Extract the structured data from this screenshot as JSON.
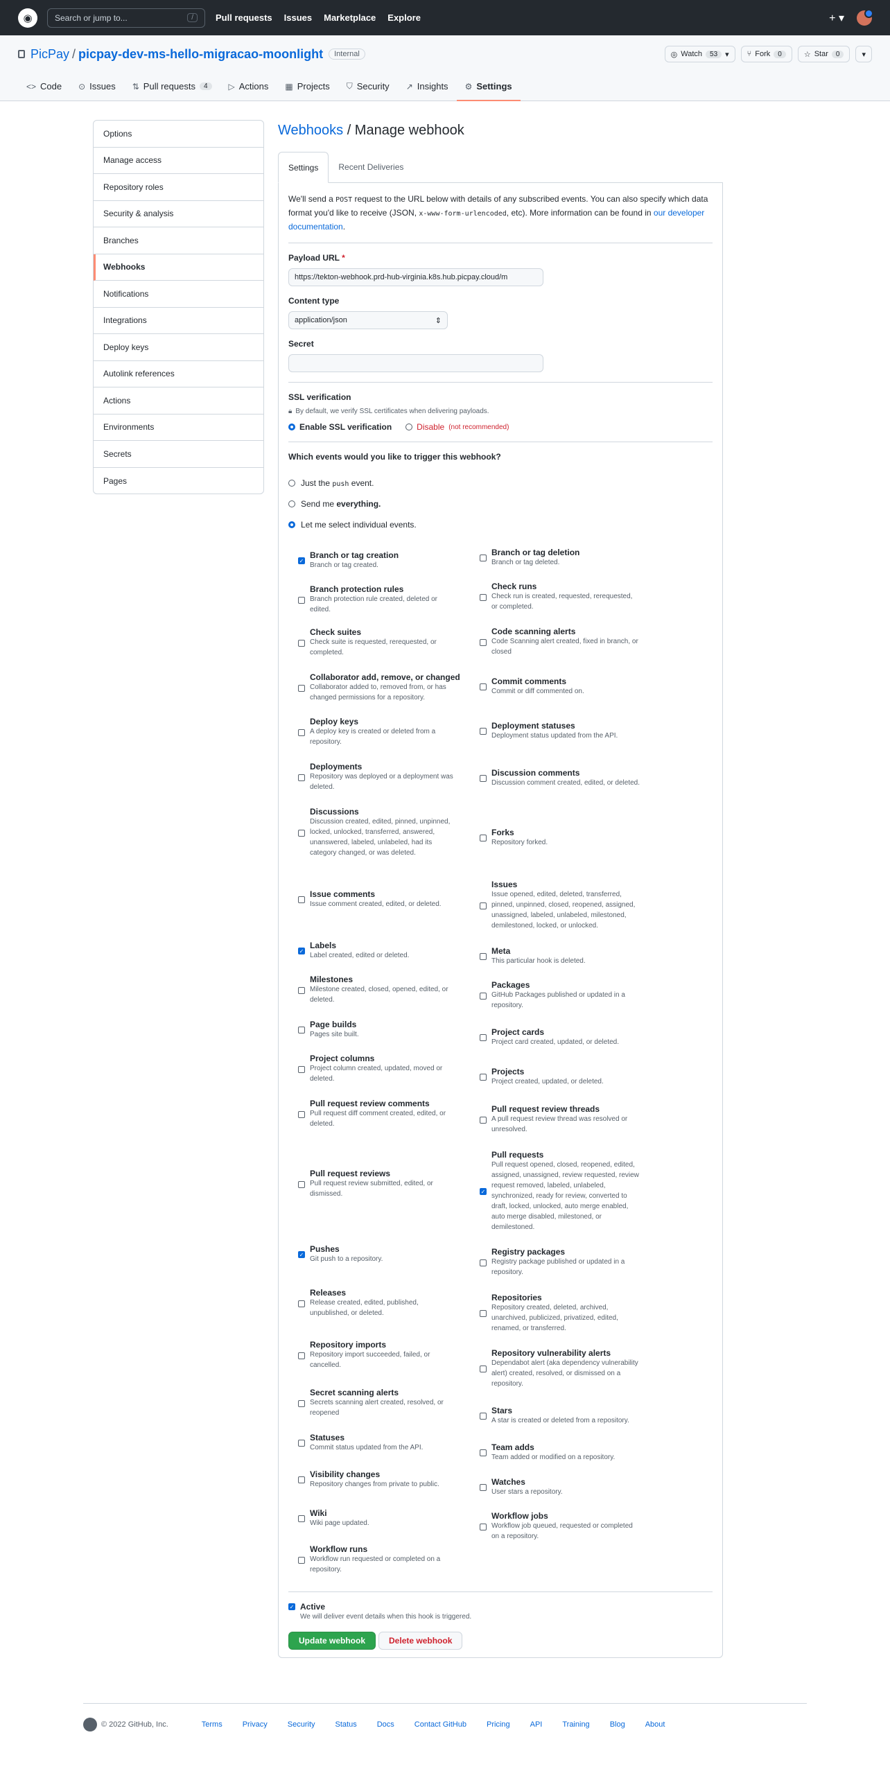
{
  "header": {
    "search_placeholder": "Search or jump to...",
    "search_key": "/",
    "nav": [
      "Pull requests",
      "Issues",
      "Marketplace",
      "Explore"
    ],
    "plus": "+ ▾"
  },
  "repo": {
    "owner": "PicPay",
    "name": "picpay-dev-ms-hello-migracao-moonlight",
    "visibility": "Internal",
    "watch_label": "Watch",
    "watch_count": "53",
    "fork_label": "Fork",
    "fork_count": "0",
    "star_label": "Star",
    "star_count": "0"
  },
  "tabs": [
    {
      "label": "Code",
      "icon": "<>"
    },
    {
      "label": "Issues",
      "icon": "⊙"
    },
    {
      "label": "Pull requests",
      "icon": "⇅",
      "count": "4"
    },
    {
      "label": "Actions",
      "icon": "▷"
    },
    {
      "label": "Projects",
      "icon": "▦"
    },
    {
      "label": "Security",
      "icon": "⛉"
    },
    {
      "label": "Insights",
      "icon": "↗"
    },
    {
      "label": "Settings",
      "icon": "⚙"
    }
  ],
  "sidebar": [
    "Options",
    "Manage access",
    "Repository roles",
    "Security & analysis",
    "Branches",
    "Webhooks",
    "Notifications",
    "Integrations",
    "Deploy keys",
    "Autolink references",
    "Actions",
    "Environments",
    "Secrets",
    "Pages"
  ],
  "page": {
    "title_link": "Webhooks",
    "title_rest": " / Manage webhook",
    "tab_settings": "Settings",
    "tab_deliveries": "Recent Deliveries",
    "intro_1": "We'll send a ",
    "intro_code1": "POST",
    "intro_2": " request to the URL below with details of any subscribed events. You can also specify which data format you'd like to receive (JSON, ",
    "intro_code2": "x-www-form-urlencoded",
    "intro_3": ", etc). More information can be found in ",
    "intro_link": "our developer documentation",
    "intro_4": ".",
    "payload_label": "Payload URL",
    "payload_value": "https://tekton-webhook.prd-hub-virginia.k8s.hub.picpay.cloud/m",
    "content_type_label": "Content type",
    "content_type_value": "application/json",
    "secret_label": "Secret",
    "ssl_label": "SSL verification",
    "ssl_note": "By default, we verify SSL certificates when delivering payloads.",
    "ssl_enable": "Enable SSL verification",
    "ssl_disable": "Disable",
    "ssl_disable_note": "(not recommended)",
    "events_question": "Which events would you like to trigger this webhook?",
    "opt_push_1": "Just the ",
    "opt_push_code": "push",
    "opt_push_2": " event.",
    "opt_all_1": "Send me ",
    "opt_all_2": "everything.",
    "opt_select": "Let me select individual events.",
    "active_label": "Active",
    "active_note": "We will deliver event details when this hook is triggered.",
    "update_button": "Update webhook",
    "delete_button": "Delete webhook"
  },
  "events_left": [
    {
      "name": "Branch or tag creation",
      "desc": "Branch or tag created.",
      "checked": true,
      "h": 56
    },
    {
      "name": "Branch protection rules",
      "desc": "Branch protection rule created, deleted or edited.",
      "checked": false,
      "h": 58
    },
    {
      "name": "Check suites",
      "desc": "Check suite is requested, rerequested, or completed.",
      "checked": false,
      "h": 66
    },
    {
      "name": "Collaborator add, remove, or changed",
      "desc": "Collaborator added to, removed from, or has changed permissions for a repository.",
      "checked": false,
      "h": 64
    },
    {
      "name": "Deploy keys",
      "desc": "A deploy key is created or deleted from a repository.",
      "checked": false,
      "h": 64
    },
    {
      "name": "Deployments",
      "desc": "Repository was deployed or a deployment was deleted.",
      "checked": false,
      "h": 66
    },
    {
      "name": "Discussions",
      "desc": "Discussion created, edited, pinned, unpinned, locked, unlocked, transferred, answered, unanswered, labeled, unlabeled, had its category changed, or was deleted.",
      "checked": false,
      "h": 94
    },
    {
      "name": "Issue comments",
      "desc": "Issue comment created, edited, or deleted.",
      "checked": false,
      "h": 98
    },
    {
      "name": "Labels",
      "desc": "Label created, edited or deleted.",
      "checked": true,
      "h": 50
    },
    {
      "name": "Milestones",
      "desc": "Milestone created, closed, opened, edited, or deleted.",
      "checked": false,
      "h": 64
    },
    {
      "name": "Page builds",
      "desc": "Pages site built.",
      "checked": false,
      "h": 50
    },
    {
      "name": "Project columns",
      "desc": "Project column created, updated, moved or deleted.",
      "checked": false,
      "h": 64
    },
    {
      "name": "Pull request review comments",
      "desc": "Pull request diff comment created, edited, or deleted.",
      "checked": false,
      "h": 66
    },
    {
      "name": "Pull request reviews",
      "desc": "Pull request review submitted, edited, or dismissed.",
      "checked": false,
      "h": 136
    },
    {
      "name": "Pushes",
      "desc": "Git push to a repository.",
      "checked": true,
      "h": 66
    },
    {
      "name": "Releases",
      "desc": "Release created, edited, published, unpublished, or deleted.",
      "checked": false,
      "h": 76
    },
    {
      "name": "Repository imports",
      "desc": "Repository import succeeded, failed, or cancelled.",
      "checked": false,
      "h": 74
    },
    {
      "name": "Secret scanning alerts",
      "desc": "Secrets scanning alert created, resolved, or reopened",
      "checked": false,
      "h": 64
    },
    {
      "name": "Statuses",
      "desc": "Commit status updated from the API.",
      "checked": false,
      "h": 50
    },
    {
      "name": "Visibility changes",
      "desc": "Repository changes from private to public.",
      "checked": false,
      "h": 56
    },
    {
      "name": "Wiki",
      "desc": "Wiki page updated.",
      "checked": false,
      "h": 56
    },
    {
      "name": "Workflow runs",
      "desc": "Workflow run requested or completed on a repository.",
      "checked": false,
      "h": 64
    }
  ],
  "events_right": [
    {
      "name": "Branch or tag deletion",
      "desc": "Branch or tag deleted.",
      "checked": false,
      "h": 48
    },
    {
      "name": "Check runs",
      "desc": "Check run is created, requested, rerequested, or completed.",
      "checked": false,
      "h": 66
    },
    {
      "name": "Code scanning alerts",
      "desc": "Code Scanning alert created, fixed in branch, or closed",
      "checked": false,
      "h": 64
    },
    {
      "name": "Commit comments",
      "desc": "Commit or diff commented on.",
      "checked": false,
      "h": 64
    },
    {
      "name": "Deployment statuses",
      "desc": "Deployment status updated from the API.",
      "checked": false,
      "h": 64
    },
    {
      "name": "Discussion comments",
      "desc": "Discussion comment created, edited, or deleted.",
      "checked": false,
      "h": 72
    },
    {
      "name": "Forks",
      "desc": "Repository forked.",
      "checked": false,
      "h": 100
    },
    {
      "name": "Issues",
      "desc": "Issue opened, edited, deleted, transferred, pinned, unpinned, closed, reopened, assigned, unassigned, labeled, unlabeled, milestoned, demilestoned, locked, or unlocked.",
      "checked": false,
      "h": 96
    },
    {
      "name": "Meta",
      "desc": "This particular hook is deleted.",
      "checked": false,
      "h": 50
    },
    {
      "name": "Packages",
      "desc": "GitHub Packages published or updated in a repository.",
      "checked": false,
      "h": 64
    },
    {
      "name": "Project cards",
      "desc": "Project card created, updated, or deleted.",
      "checked": false,
      "h": 56
    },
    {
      "name": "Projects",
      "desc": "Project created, updated, or deleted.",
      "checked": false,
      "h": 58
    },
    {
      "name": "Pull request review threads",
      "desc": "A pull request review thread was resolved or unresolved.",
      "checked": false,
      "h": 66
    },
    {
      "name": "Pull requests",
      "desc": "Pull request opened, closed, reopened, edited, assigned, unassigned, review requested, review request removed, labeled, unlabeled, synchronized, ready for review, converted to draft, locked, unlocked, auto merge enabled, auto merge disabled, milestoned, or demilestoned.",
      "checked": true,
      "h": 140
    },
    {
      "name": "Registry packages",
      "desc": "Registry package published or updated in a repository.",
      "checked": false,
      "h": 66
    },
    {
      "name": "Repositories",
      "desc": "Repository created, deleted, archived, unarchived, publicized, privatized, edited, renamed, or transferred.",
      "checked": false,
      "h": 80
    },
    {
      "name": "Repository vulnerability alerts",
      "desc": "Dependabot alert (aka dependency vulnerability alert) created, resolved, or dismissed on a repository.",
      "checked": false,
      "h": 80
    },
    {
      "name": "Stars",
      "desc": "A star is created or deleted from a repository.",
      "checked": false,
      "h": 56
    },
    {
      "name": "Team adds",
      "desc": "Team added or modified on a repository.",
      "checked": false,
      "h": 50
    },
    {
      "name": "Watches",
      "desc": "User stars a repository.",
      "checked": false,
      "h": 50
    },
    {
      "name": "Workflow jobs",
      "desc": "Workflow job queued, requested or completed on a repository.",
      "checked": false,
      "h": 64
    }
  ],
  "footer": {
    "copyright": "© 2022 GitHub, Inc.",
    "links": [
      "Terms",
      "Privacy",
      "Security",
      "Status",
      "Docs",
      "Contact GitHub",
      "Pricing",
      "API",
      "Training",
      "Blog",
      "About"
    ]
  }
}
